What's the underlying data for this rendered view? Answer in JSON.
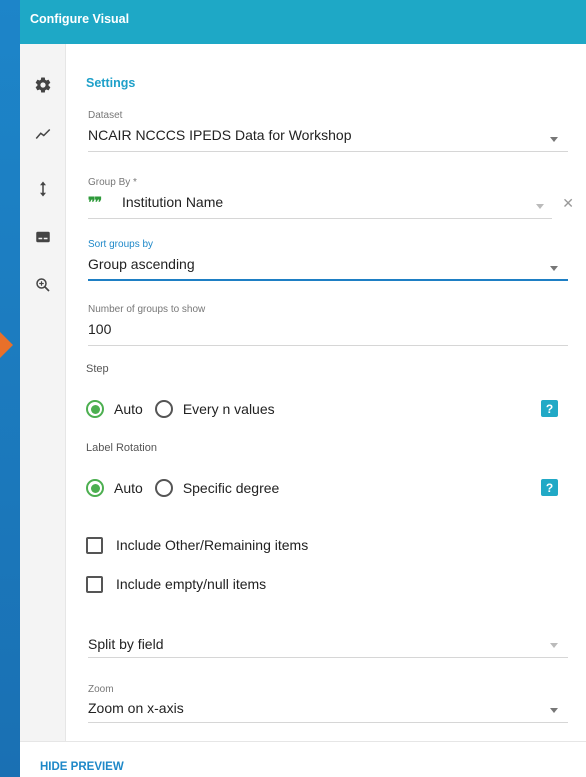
{
  "header": {
    "title": "Configure Visual"
  },
  "sidebar": {
    "icons": [
      {
        "name": "gear-icon"
      },
      {
        "name": "trend-icon"
      },
      {
        "name": "vertical-arrows-icon"
      },
      {
        "name": "subtitles-icon"
      },
      {
        "name": "zoom-in-icon"
      }
    ]
  },
  "settings": {
    "title": "Settings",
    "dataset": {
      "label": "Dataset",
      "value": "NCAIR NCCCS IPEDS Data for Workshop"
    },
    "group_by": {
      "label": "Group By *",
      "value": "Institution Name",
      "quote_icon": "❞❞"
    },
    "sort_groups": {
      "label": "Sort groups by",
      "value": "Group ascending"
    },
    "num_groups": {
      "label": "Number of groups to show",
      "value": "100"
    },
    "step": {
      "label": "Step",
      "options": [
        "Auto",
        "Every n values"
      ],
      "selected": "Auto",
      "help": "?"
    },
    "label_rotation": {
      "label": "Label Rotation",
      "options": [
        "Auto",
        "Specific degree"
      ],
      "selected": "Auto",
      "help": "?"
    },
    "include_other": {
      "label": "Include Other/Remaining items",
      "checked": false
    },
    "include_empty": {
      "label": "Include empty/null items",
      "checked": false
    },
    "split_by": {
      "placeholder": "Split by field"
    },
    "zoom": {
      "label": "Zoom",
      "value": "Zoom on x-axis"
    }
  },
  "footer": {
    "hide_preview": "HIDE PREVIEW"
  },
  "colors": {
    "header": "#1ea8c6",
    "accent_blue": "#1e88c8",
    "radio_green": "#4caf50",
    "background_blue": "#1b78c0",
    "arrow_orange": "#e8702a"
  }
}
